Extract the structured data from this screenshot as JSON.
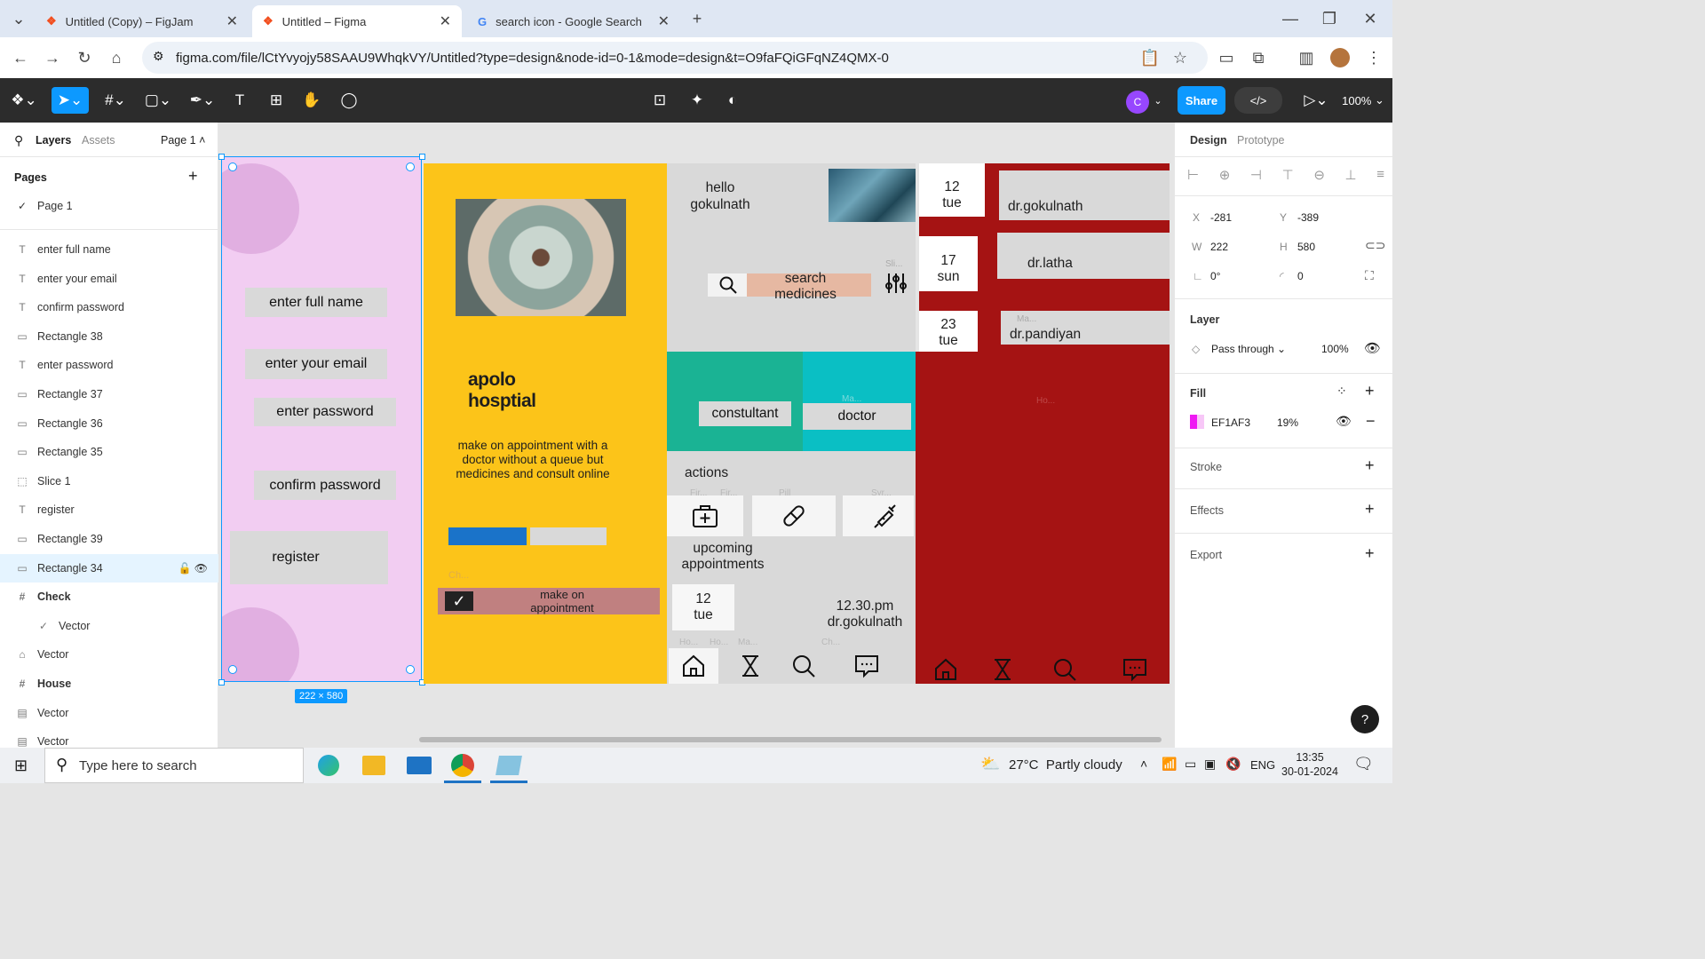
{
  "browser": {
    "tabs": [
      {
        "title": "Untitled (Copy) – FigJam"
      },
      {
        "title": "Untitled – Figma"
      },
      {
        "title": "search icon - Google Search"
      }
    ],
    "url": "figma.com/file/lCtYvyojy58SAAU9WhqkVY/Untitled?type=design&node-id=0-1&mode=design&t=O9faFQiGFqNZ4QMX-0"
  },
  "toolbar": {
    "avatar_initial": "C",
    "share_label": "Share",
    "zoom": "100%"
  },
  "left_panel": {
    "tabs": {
      "layers": "Layers",
      "assets": "Assets"
    },
    "page_select": "Page 1",
    "pages_title": "Pages",
    "current_page": "Page 1",
    "layers": [
      {
        "name": "enter full name",
        "icon": "text-icon"
      },
      {
        "name": "enter your email",
        "icon": "text-icon"
      },
      {
        "name": "confirm password",
        "icon": "text-icon"
      },
      {
        "name": "Rectangle 38",
        "icon": "rectangle-icon"
      },
      {
        "name": "enter password",
        "icon": "text-icon"
      },
      {
        "name": "Rectangle 37",
        "icon": "rectangle-icon"
      },
      {
        "name": "Rectangle 36",
        "icon": "rectangle-icon"
      },
      {
        "name": "Rectangle 35",
        "icon": "rectangle-icon"
      },
      {
        "name": "Slice 1",
        "icon": "slice-icon"
      },
      {
        "name": "register",
        "icon": "text-icon"
      },
      {
        "name": "Rectangle 39",
        "icon": "rectangle-icon"
      },
      {
        "name": "Rectangle 34",
        "icon": "rectangle-icon"
      },
      {
        "name": "Check",
        "icon": "frame-icon"
      },
      {
        "name": "Vector",
        "icon": "check-icon"
      },
      {
        "name": "Vector",
        "icon": "house-icon"
      },
      {
        "name": "House",
        "icon": "frame-icon"
      },
      {
        "name": "Vector",
        "icon": "vector-icon"
      },
      {
        "name": "Vector",
        "icon": "vector-icon"
      }
    ]
  },
  "canvas": {
    "register_frame": {
      "full_name": "enter full name",
      "email": "enter your email",
      "password": "enter password",
      "confirm": "confirm password",
      "register": "register",
      "size_badge": "222 × 580"
    },
    "yellow_frame": {
      "title": "apolo\nhosptial",
      "desc": "make on  appointment with a doctor without a queue but medicines and consult online",
      "faded_ch": "Ch...",
      "appointment_btn": "make on\nappointment"
    },
    "home_frame": {
      "greeting": "hello\ngokulnath",
      "slider_label": "Sli...",
      "search": "search\nmedicines",
      "constultant": "constultant",
      "doctor": "doctor",
      "faded_ma": "Ma...",
      "actions": "actions",
      "faded_labels": [
        "Fir...",
        "Fir...",
        "Pill",
        "Syr..."
      ],
      "upcoming": "upcoming\nappointments",
      "date": "12\ntue",
      "time": "12.30.pm\ndr.gokulnath",
      "faded_bottom": [
        "Ho...",
        "Ho...",
        "Ma...",
        "Ch..."
      ]
    },
    "dates": [
      {
        "text": "12\ntue"
      },
      {
        "text": "17\nsun"
      },
      {
        "text": "23\ntue"
      }
    ],
    "doctors": [
      "dr.gokulnath",
      "dr.latha",
      "dr.pandiyan"
    ],
    "faded_red": [
      "Ma...",
      "Ho..."
    ]
  },
  "right_panel": {
    "tabs": {
      "design": "Design",
      "prototype": "Prototype"
    },
    "x": "-281",
    "y": "-389",
    "w": "222",
    "h": "580",
    "rotation": "0°",
    "radius": "0",
    "labels": {
      "x": "X",
      "y": "Y",
      "w": "W",
      "h": "H"
    },
    "layer_title": "Layer",
    "blend": "Pass through",
    "opacity": "100%",
    "fill_title": "Fill",
    "fill_hex": "EF1AF3",
    "fill_opacity": "19%",
    "fill_color": "#ef1af3",
    "stroke": "Stroke",
    "effects": "Effects",
    "export": "Export"
  },
  "taskbar": {
    "search_placeholder": "Type here to search",
    "weather": "27°C  Partly cloudy",
    "lang": "ENG",
    "time": "13:35",
    "date": "30-01-2024"
  },
  "colors": {
    "figma_blue": "#0d99ff",
    "frame_pink": "#f2cdf2",
    "yellow": "#fcc419",
    "dark_red": "#a51313",
    "teal": "#1ab394",
    "cyan": "#0abfc4"
  }
}
